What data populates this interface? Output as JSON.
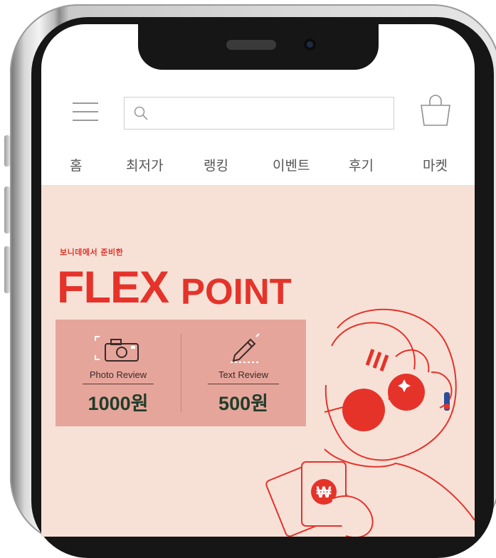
{
  "search": {
    "placeholder": ""
  },
  "nav": {
    "items": [
      {
        "label": "홈"
      },
      {
        "label": "최저가"
      },
      {
        "label": "랭킹"
      },
      {
        "label": "이벤트"
      },
      {
        "label": "후기"
      },
      {
        "label": "마켓"
      }
    ]
  },
  "banner": {
    "kicker": "보니데에서 준비한",
    "title_flex": "FLEX",
    "title_point": "POINT",
    "rewards": [
      {
        "label": "Photo Review",
        "amount": "1000원",
        "icon": "camera-icon"
      },
      {
        "label": "Text Review",
        "amount": "500원",
        "icon": "pencil-icon"
      }
    ]
  },
  "colors": {
    "accent": "#e5332a",
    "banner_bg": "#f7e1d7",
    "reward_box": "#e6a59b",
    "amount": "#1f3d2a"
  }
}
